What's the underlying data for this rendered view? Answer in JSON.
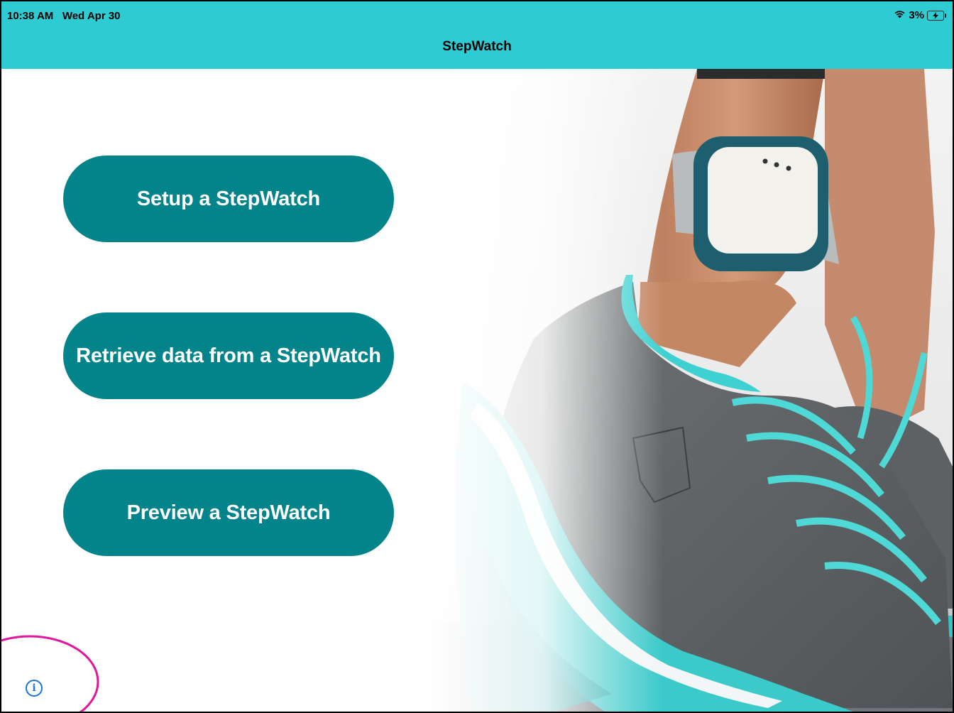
{
  "status_bar": {
    "time": "10:38 AM",
    "date": "Wed Apr 30",
    "battery_percent": "3%",
    "icons": [
      "wifi-icon",
      "battery-charging-icon"
    ]
  },
  "nav": {
    "title": "StepWatch"
  },
  "buttons": {
    "setup_label": "Setup a StepWatch",
    "retrieve_label": "Retrieve data from a StepWatch",
    "preview_label": "Preview a StepWatch"
  },
  "info": {
    "icon": "info-icon"
  },
  "colors": {
    "nav_background": "#2ecbd3",
    "button_background": "#03848a",
    "button_text": "#ffffff",
    "info_icon": "#1a73e8",
    "annotation_circle": "#e0189a"
  }
}
